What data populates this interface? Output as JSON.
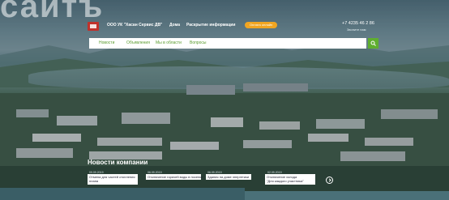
{
  "overlay": {
    "big_text": "сайтъ"
  },
  "header": {
    "company": "ООО УК \"Хасан Сервис ДВ\"",
    "nav": [
      "Дома",
      "Раскрытие информации"
    ],
    "cta": "Оплата онлайн",
    "phone": "+7 4235 46 2 86",
    "phone_note": "Звоните нам"
  },
  "navbar": {
    "items": [
      "Новости",
      "Объявления",
      "Мы в области",
      "Вопросы"
    ]
  },
  "news": {
    "title": "Новости компании",
    "items": [
      {
        "date": "09.09.2019",
        "text": "Отмена для частей отопления\nплана"
      },
      {
        "date": "06.09.2019",
        "text": "Отключение горячей воды в поселке"
      },
      {
        "date": "06.09.2019",
        "text": "Здания на доме энергетики"
      },
      {
        "date": "02.09.2019",
        "text": "Отключение холода\n\"Для каждого участника\""
      }
    ]
  },
  "colors": {
    "accent_green": "#5fae2f",
    "cta_orange": "#f1a521",
    "logo_red": "#c0312b"
  }
}
